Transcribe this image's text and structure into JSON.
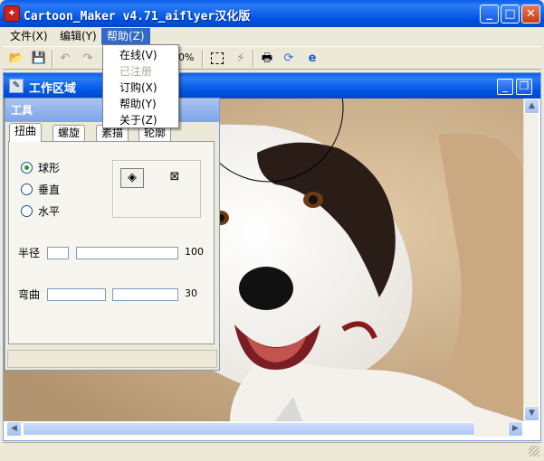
{
  "window": {
    "title": "Cartoon_Maker v4.71_aiflyer汉化版",
    "app_icon": "cartoon-maker-app-icon"
  },
  "menubar": {
    "items": [
      {
        "label": "文件(X)"
      },
      {
        "label": "编辑(Y)"
      },
      {
        "label": "帮助(Z)",
        "open": true
      }
    ]
  },
  "help_menu": {
    "items": [
      {
        "label": "在线(V)",
        "disabled": false
      },
      {
        "label": "已注册",
        "disabled": true
      },
      {
        "label": "订购(X)",
        "disabled": false
      },
      {
        "label": "帮助(Y)",
        "disabled": false
      },
      {
        "label": "关于(Z)",
        "disabled": false
      }
    ]
  },
  "toolbar": {
    "zoom_text": "0%",
    "icons": [
      "open-folder-icon",
      "save-icon",
      "undo-icon",
      "redo-icon",
      "select-rectangle-icon",
      "magic-wand-icon",
      "print-icon",
      "refresh-icon",
      "ie-icon"
    ]
  },
  "child_window": {
    "title": "工作区域"
  },
  "tool_panel": {
    "title": "工具",
    "tabs": [
      "扭曲",
      "螺旋",
      "素描",
      "轮廓"
    ],
    "active_tab": "扭曲",
    "radio_options": [
      {
        "label": "球形",
        "checked": true
      },
      {
        "label": "垂直",
        "checked": false
      },
      {
        "label": "水平",
        "checked": false
      }
    ],
    "radius_label": "半径",
    "radius_value": "100",
    "bend_label": "弯曲",
    "bend_value": "30"
  },
  "colors": {
    "titlebar": "#0054e3",
    "menu_highlight": "#316ac5",
    "panel_face": "#ece9d8"
  }
}
